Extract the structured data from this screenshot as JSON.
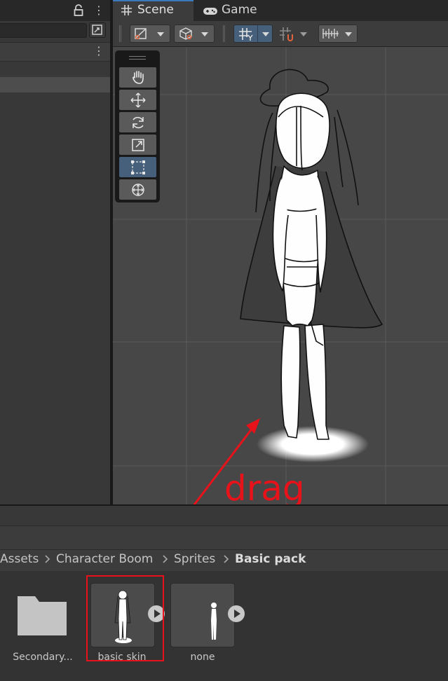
{
  "scene_tabs": [
    {
      "label": "Scene",
      "icon": "hash-grid-icon",
      "active": true
    },
    {
      "label": "Game",
      "icon": "gamepad-icon",
      "active": false
    }
  ],
  "left_panel": {
    "header_icons": [
      "lock-icon",
      "kebab-menu-icon"
    ],
    "search_value": "",
    "row_menu_icon": "kebab-menu-icon"
  },
  "scene_toolbar": {
    "buttons": [
      "draw-mode-icon",
      "render-mode-icon",
      "grid-snap-icon",
      "increment-snap-icon",
      "ruler-icon"
    ]
  },
  "tool_palette": {
    "tools": [
      "hand-tool",
      "move-tool",
      "rotate-tool",
      "scale-tool",
      "rect-tool",
      "transform-tool"
    ],
    "active_tool": "rect-tool"
  },
  "breadcrumb": [
    {
      "label": "Assets",
      "current": false
    },
    {
      "label": "Character Boom",
      "current": false
    },
    {
      "label": "Sprites",
      "current": false
    },
    {
      "label": "Basic pack",
      "current": true
    }
  ],
  "assets": [
    {
      "label": "Secondary...",
      "type": "folder"
    },
    {
      "label": "basic skin",
      "type": "sprite",
      "selected": true
    },
    {
      "label": "none",
      "type": "sprite",
      "selected": false
    }
  ],
  "annotation": {
    "text": "drag",
    "color": "#e8121a"
  },
  "colors": {
    "accent": "#3a79bb",
    "active_button": "#46607c",
    "annotation_red": "#e8121a"
  }
}
